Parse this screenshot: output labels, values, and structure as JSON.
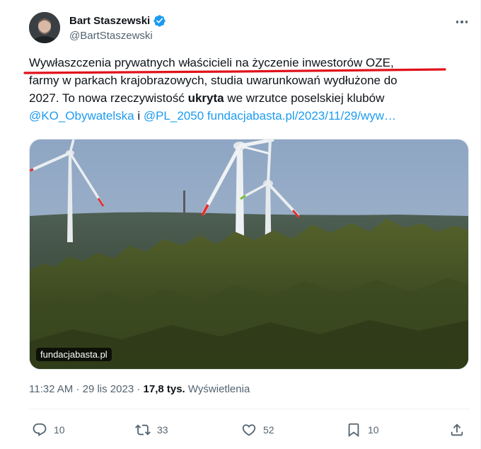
{
  "author": {
    "name": "Bart Staszewski",
    "handle": "@BartStaszewski"
  },
  "tweet": {
    "line1": "Wywłaszczenia prywatnych właścicieli na życzenie inwestorów OZE,",
    "line2": "farmy w parkach krajobrazowych, studia uwarunkowań wydłużone do",
    "line3_pre": "2027. To nowa rzeczywistość ",
    "line3_bold": "ukryta",
    "line3_post": " we wrzutce poselskiej klubów",
    "mention1": "@KO_Obywatelska",
    "conj": " i ",
    "mention2": "@PL_2050",
    "link": "fundacjabasta.pl/2023/11/29/wyw…"
  },
  "media": {
    "label": "fundacjabasta.pl"
  },
  "meta": {
    "time": "11:32 AM",
    "sep1": " · ",
    "date": "29 lis 2023",
    "sep2": " · ",
    "views_count": "17,8 tys.",
    "views_label": " Wyświetlenia"
  },
  "actions": {
    "replies": "10",
    "reposts": "33",
    "likes": "52",
    "bookmarks": "10"
  },
  "colors": {
    "accent": "#1d9bf0",
    "annotation": "#e0121b",
    "secondary_text": "#536471"
  },
  "icons": [
    "more-icon",
    "verified-badge-icon",
    "reply-icon",
    "repost-icon",
    "like-icon",
    "bookmark-icon",
    "share-icon"
  ]
}
